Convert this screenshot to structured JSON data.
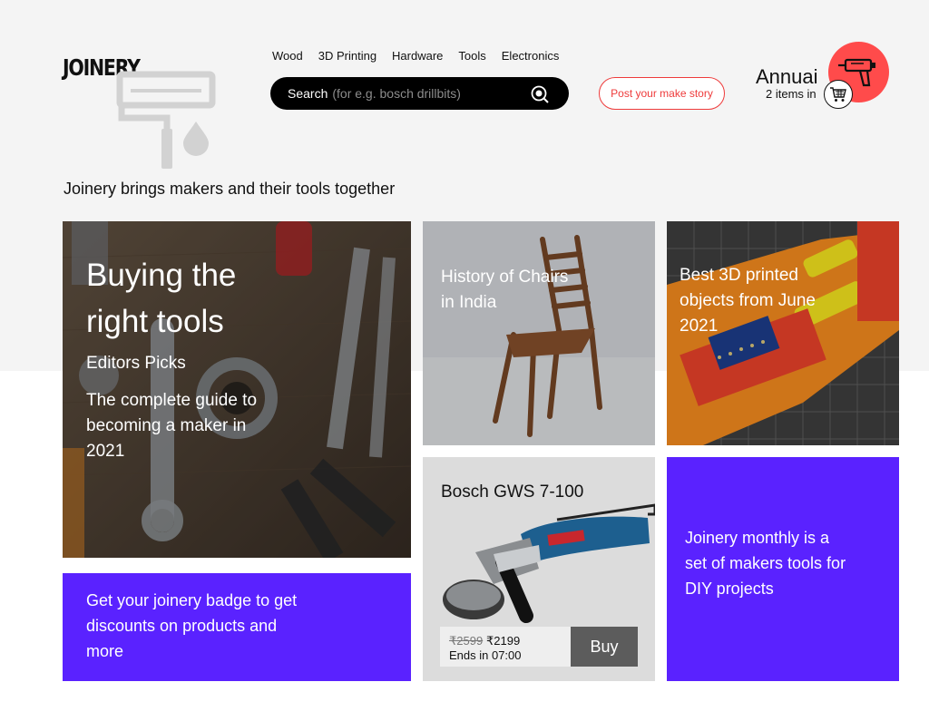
{
  "brand": {
    "logo_text": "JOINERY"
  },
  "nav": {
    "items": [
      {
        "label": "Wood"
      },
      {
        "label": "3D Printing"
      },
      {
        "label": "Hardware"
      },
      {
        "label": "Tools"
      },
      {
        "label": "Electronics"
      }
    ]
  },
  "search": {
    "label": "Search",
    "placeholder": "(for e.g. bosch drillbits)",
    "icon": "search-icon"
  },
  "post_button": {
    "label": "Post your make story"
  },
  "cart": {
    "title": "Annuai",
    "items_text": "2 items in",
    "icon": "cart-icon",
    "badge_icon": "drill-icon",
    "accent_color": "#ff4b4b"
  },
  "tagline": "Joinery brings makers and their tools together",
  "cards": {
    "tools": {
      "title": "Buying the right tools",
      "subtitle": "Editors Picks",
      "description": "The complete guide to becoming a maker in 2021"
    },
    "chairs": {
      "title": "History of Chairs in India"
    },
    "printed": {
      "title": "Best 3D printed objects from June 2021"
    },
    "badge": {
      "title": "Get your joinery badge to get discounts on products and more",
      "color": "#5a22ff"
    },
    "product": {
      "name": "Bosch GWS 7-100",
      "old_price": "₹2599",
      "new_price": "₹2199",
      "ends": "Ends in 07:00",
      "buy_label": "Buy"
    },
    "monthly": {
      "title": "Joinery monthly is a set of makers tools for DIY projects",
      "color": "#5a22ff"
    }
  }
}
